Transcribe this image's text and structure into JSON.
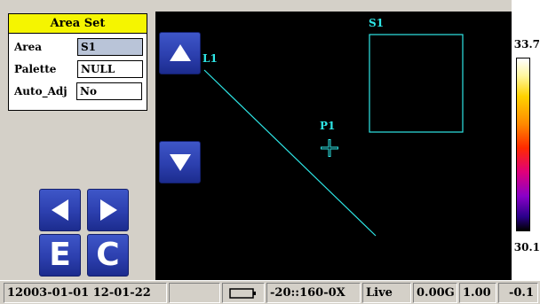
{
  "area_set": {
    "title": "Area Set",
    "rows": [
      {
        "label": "Area",
        "value": "S1"
      },
      {
        "label": "Palette",
        "value": "NULL"
      },
      {
        "label": "Auto_Adj",
        "value": "No"
      }
    ]
  },
  "nav": {
    "left_icon": "arrow-left-icon",
    "right_icon": "arrow-right-icon",
    "up_icon": "arrow-up-icon",
    "down_icon": "arrow-down-icon",
    "e_label": "E",
    "c_label": "C"
  },
  "view": {
    "line_label": "L1",
    "area_label": "S1",
    "point_label": "P1"
  },
  "scale": {
    "max": "33.7",
    "min": "30.1"
  },
  "status": {
    "datetime": "12003-01-01 12-01-22",
    "battery_icon": "battery-icon",
    "range": "-20::160-0X",
    "mode": "Live",
    "gain": "0.00G",
    "emissivity": "1.00",
    "offset": "-0.1"
  },
  "colors": {
    "overlay": "#2ee6e6",
    "title_bg": "#f5f500",
    "button_blue": "#2c3fae"
  }
}
